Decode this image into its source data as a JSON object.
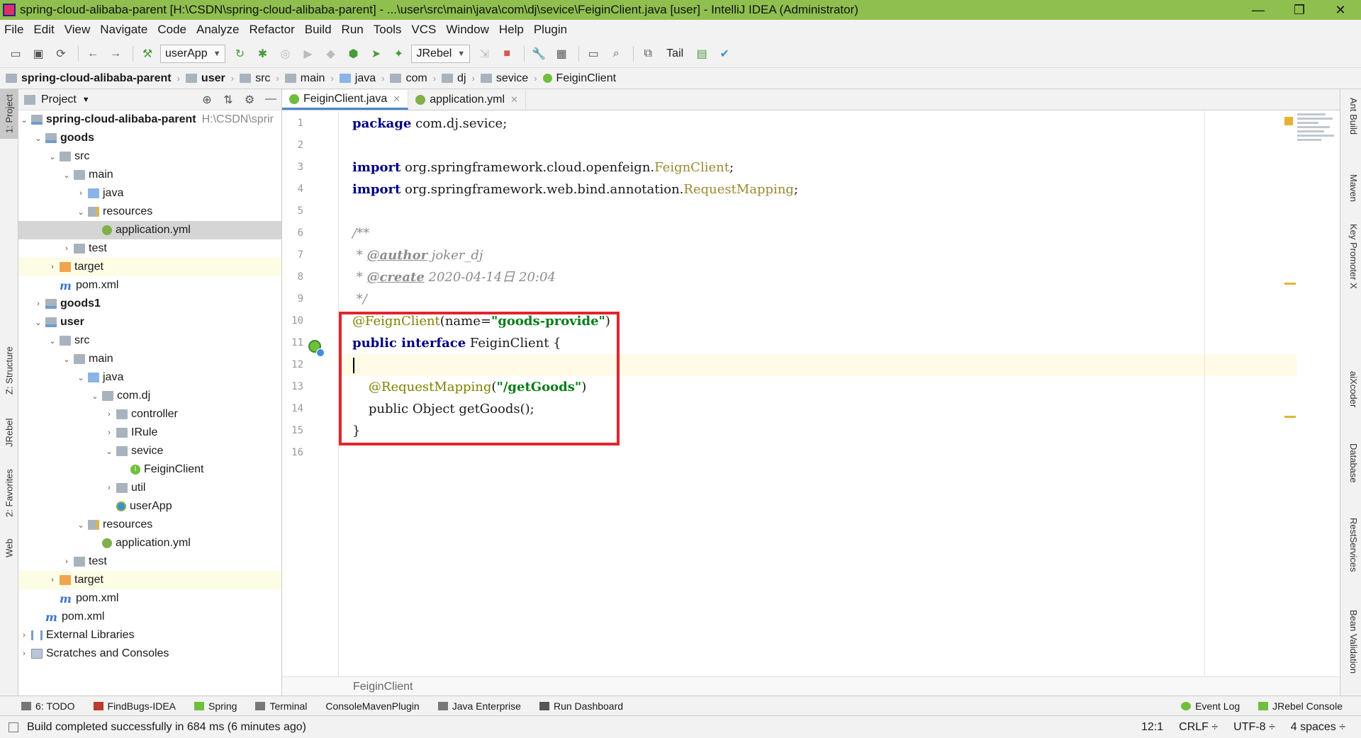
{
  "window": {
    "title": "spring-cloud-alibaba-parent [H:\\CSDN\\spring-cloud-alibaba-parent] - ...\\user\\src\\main\\java\\com\\dj\\sevice\\FeiginClient.java [user] - IntelliJ IDEA (Administrator)",
    "minimize": "—",
    "maximize": "❐",
    "close": "✕"
  },
  "menu": [
    "File",
    "Edit",
    "View",
    "Navigate",
    "Code",
    "Analyze",
    "Refactor",
    "Build",
    "Run",
    "Tools",
    "VCS",
    "Window",
    "Help",
    "Plugin"
  ],
  "toolbar": {
    "run_config": "userApp",
    "jrebel": "JRebel",
    "tail": "Tail"
  },
  "nav": [
    "spring-cloud-alibaba-parent",
    "user",
    "src",
    "main",
    "java",
    "com",
    "dj",
    "sevice",
    "FeiginClient"
  ],
  "left_tabs": {
    "project": "1: Project",
    "structure": "Z: Structure",
    "jrebel": "JRebel",
    "favorites": "2: Favorites",
    "web": "Web"
  },
  "right_tabs": {
    "ant": "Ant Build",
    "maven": "Maven",
    "key": "Key Promoter X",
    "aixcoder": "aiXcoder",
    "database": "Database",
    "rest": "RestServices",
    "bean": "Bean Validation"
  },
  "project": {
    "header": "Project",
    "tree": [
      {
        "label": "spring-cloud-alibaba-parent",
        "path": "H:\\CSDN\\sprir",
        "bold": true
      },
      {
        "label": "goods",
        "bold": true
      },
      {
        "label": "src"
      },
      {
        "label": "main"
      },
      {
        "label": "java"
      },
      {
        "label": "resources"
      },
      {
        "label": "application.yml"
      },
      {
        "label": "test"
      },
      {
        "label": "target"
      },
      {
        "label": "pom.xml"
      },
      {
        "label": "goods1",
        "bold": true
      },
      {
        "label": "user",
        "bold": true
      },
      {
        "label": "src"
      },
      {
        "label": "main"
      },
      {
        "label": "java"
      },
      {
        "label": "com.dj"
      },
      {
        "label": "controller"
      },
      {
        "label": "IRule"
      },
      {
        "label": "sevice"
      },
      {
        "label": "FeiginClient"
      },
      {
        "label": "util"
      },
      {
        "label": "userApp"
      },
      {
        "label": "resources"
      },
      {
        "label": "application.yml"
      },
      {
        "label": "test"
      },
      {
        "label": "target"
      },
      {
        "label": "pom.xml"
      },
      {
        "label": "pom.xml"
      },
      {
        "label": "External Libraries"
      },
      {
        "label": "Scratches and Consoles"
      }
    ]
  },
  "editor": {
    "tabs": [
      {
        "label": "FeiginClient.java",
        "active": true
      },
      {
        "label": "application.yml",
        "active": false
      }
    ],
    "line_numbers": [
      "1",
      "2",
      "3",
      "4",
      "5",
      "6",
      "7",
      "8",
      "9",
      "10",
      "11",
      "12",
      "13",
      "14",
      "15",
      "16"
    ],
    "code": {
      "l1_kw": "package",
      "l1_rest": " com.dj.sevice;",
      "l3_kw": "import",
      "l3_pkg": " org.springframework.cloud.openfeign.",
      "l3_cls": "FeignClient",
      "l3_end": ";",
      "l4_kw": "import",
      "l4_pkg": " org.springframework.web.bind.annotation.",
      "l4_cls": "RequestMapping",
      "l4_end": ";",
      "l6": "/**",
      "l7_pre": " * ",
      "l7_tag": "@author",
      "l7_rest": " joker_dj",
      "l8_pre": " * ",
      "l8_tag": "@create",
      "l8_rest": " 2020-04-14日 20:04",
      "l9": " */",
      "l10_ann": "@FeignClient",
      "l10_p1": "(name=",
      "l10_str": "\"goods-provide\"",
      "l10_p2": ")",
      "l11_kw1": "public",
      "l11_kw2": " interface",
      "l11_rest": " FeiginClient {",
      "l13_pre": "    ",
      "l13_ann": "@RequestMapping",
      "l13_p1": "(",
      "l13_str": "\"/getGoods\"",
      "l13_p2": ")",
      "l14": "    public Object getGoods();",
      "l15": "}"
    },
    "breadcrumb": "FeiginClient"
  },
  "bottom_tabs": [
    "6: TODO",
    "FindBugs-IDEA",
    "Spring",
    "Terminal",
    "ConsoleMavenPlugin",
    "Java Enterprise",
    "Run Dashboard",
    "Event Log",
    "JRebel Console"
  ],
  "status": {
    "message": "Build completed successfully in 684 ms (6 minutes ago)",
    "position": "12:1",
    "line_sep": "CRLF ÷",
    "encoding": "UTF-8 ÷",
    "indent": "4 spaces ÷"
  }
}
